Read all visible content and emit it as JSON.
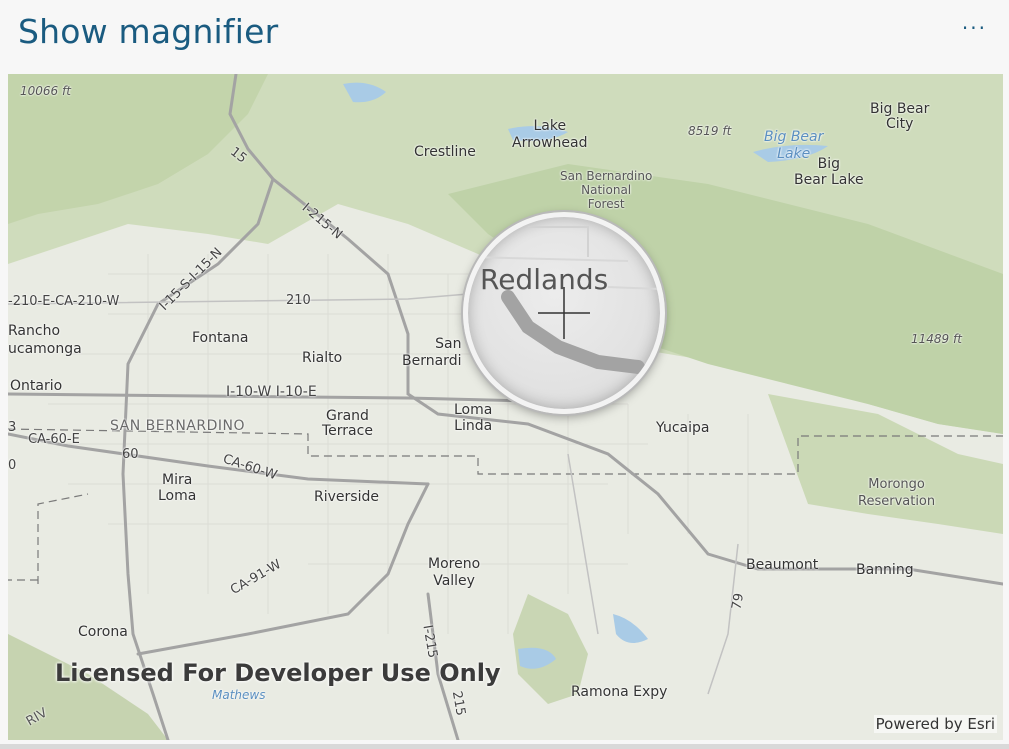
{
  "header": {
    "title": "Show magnifier",
    "more_label": "···"
  },
  "map": {
    "places": {
      "big_bear_city": "Big Bear\nCity",
      "lake_arrowhead": "Lake\nArrowhead",
      "crestline": "Crestline",
      "sb_forest": "San Bernardino\nNational\nForest",
      "big_bear_lake_water": "Big Bear\nLake",
      "big_bear_lake": "Big\nBear Lake",
      "rancho": "Rancho\nucamonga",
      "fontana": "Fontana",
      "rialto": "Rialto",
      "san_bernardino": "San\nBernardi",
      "ontario": "Ontario",
      "grand_terrace": "Grand\nTerrace",
      "loma_linda": "Loma\nLinda",
      "yucaipa": "Yucaipa",
      "sb_county": "SAN BERNARDINO",
      "mira_loma": "Mira\nLoma",
      "riverside": "Riverside",
      "morongo": "Morongo\nReservation",
      "moreno_valley": "Moreno\nValley",
      "beaumont": "Beaumont",
      "banning": "Banning",
      "corona": "Corona",
      "mathews": "Mathews",
      "ramona": "Ramona Expy",
      "river": "RIV"
    },
    "elevations": {
      "e1": "10066 ft",
      "e2": "8519 ft",
      "e3": "11489 ft"
    },
    "highways": {
      "i15": "15",
      "i215n": "I-215-N",
      "i15s": "I-15-S-I-15-N",
      "ca210": "-210-E-CA-210-W",
      "r210": "210",
      "i10": "I-10-W I-10-E",
      "ca60e": "CA-60-E",
      "r60": "60",
      "ca60w": "CA-60-W",
      "ca91w": "CA-91-W",
      "i215": "I-215",
      "r215": "215",
      "r79": "79",
      "r3": "3",
      "r0": "0"
    },
    "license": "Licensed For Developer Use Only",
    "attribution": "Powered by Esri"
  },
  "magnifier": {
    "text": "Redlands"
  }
}
